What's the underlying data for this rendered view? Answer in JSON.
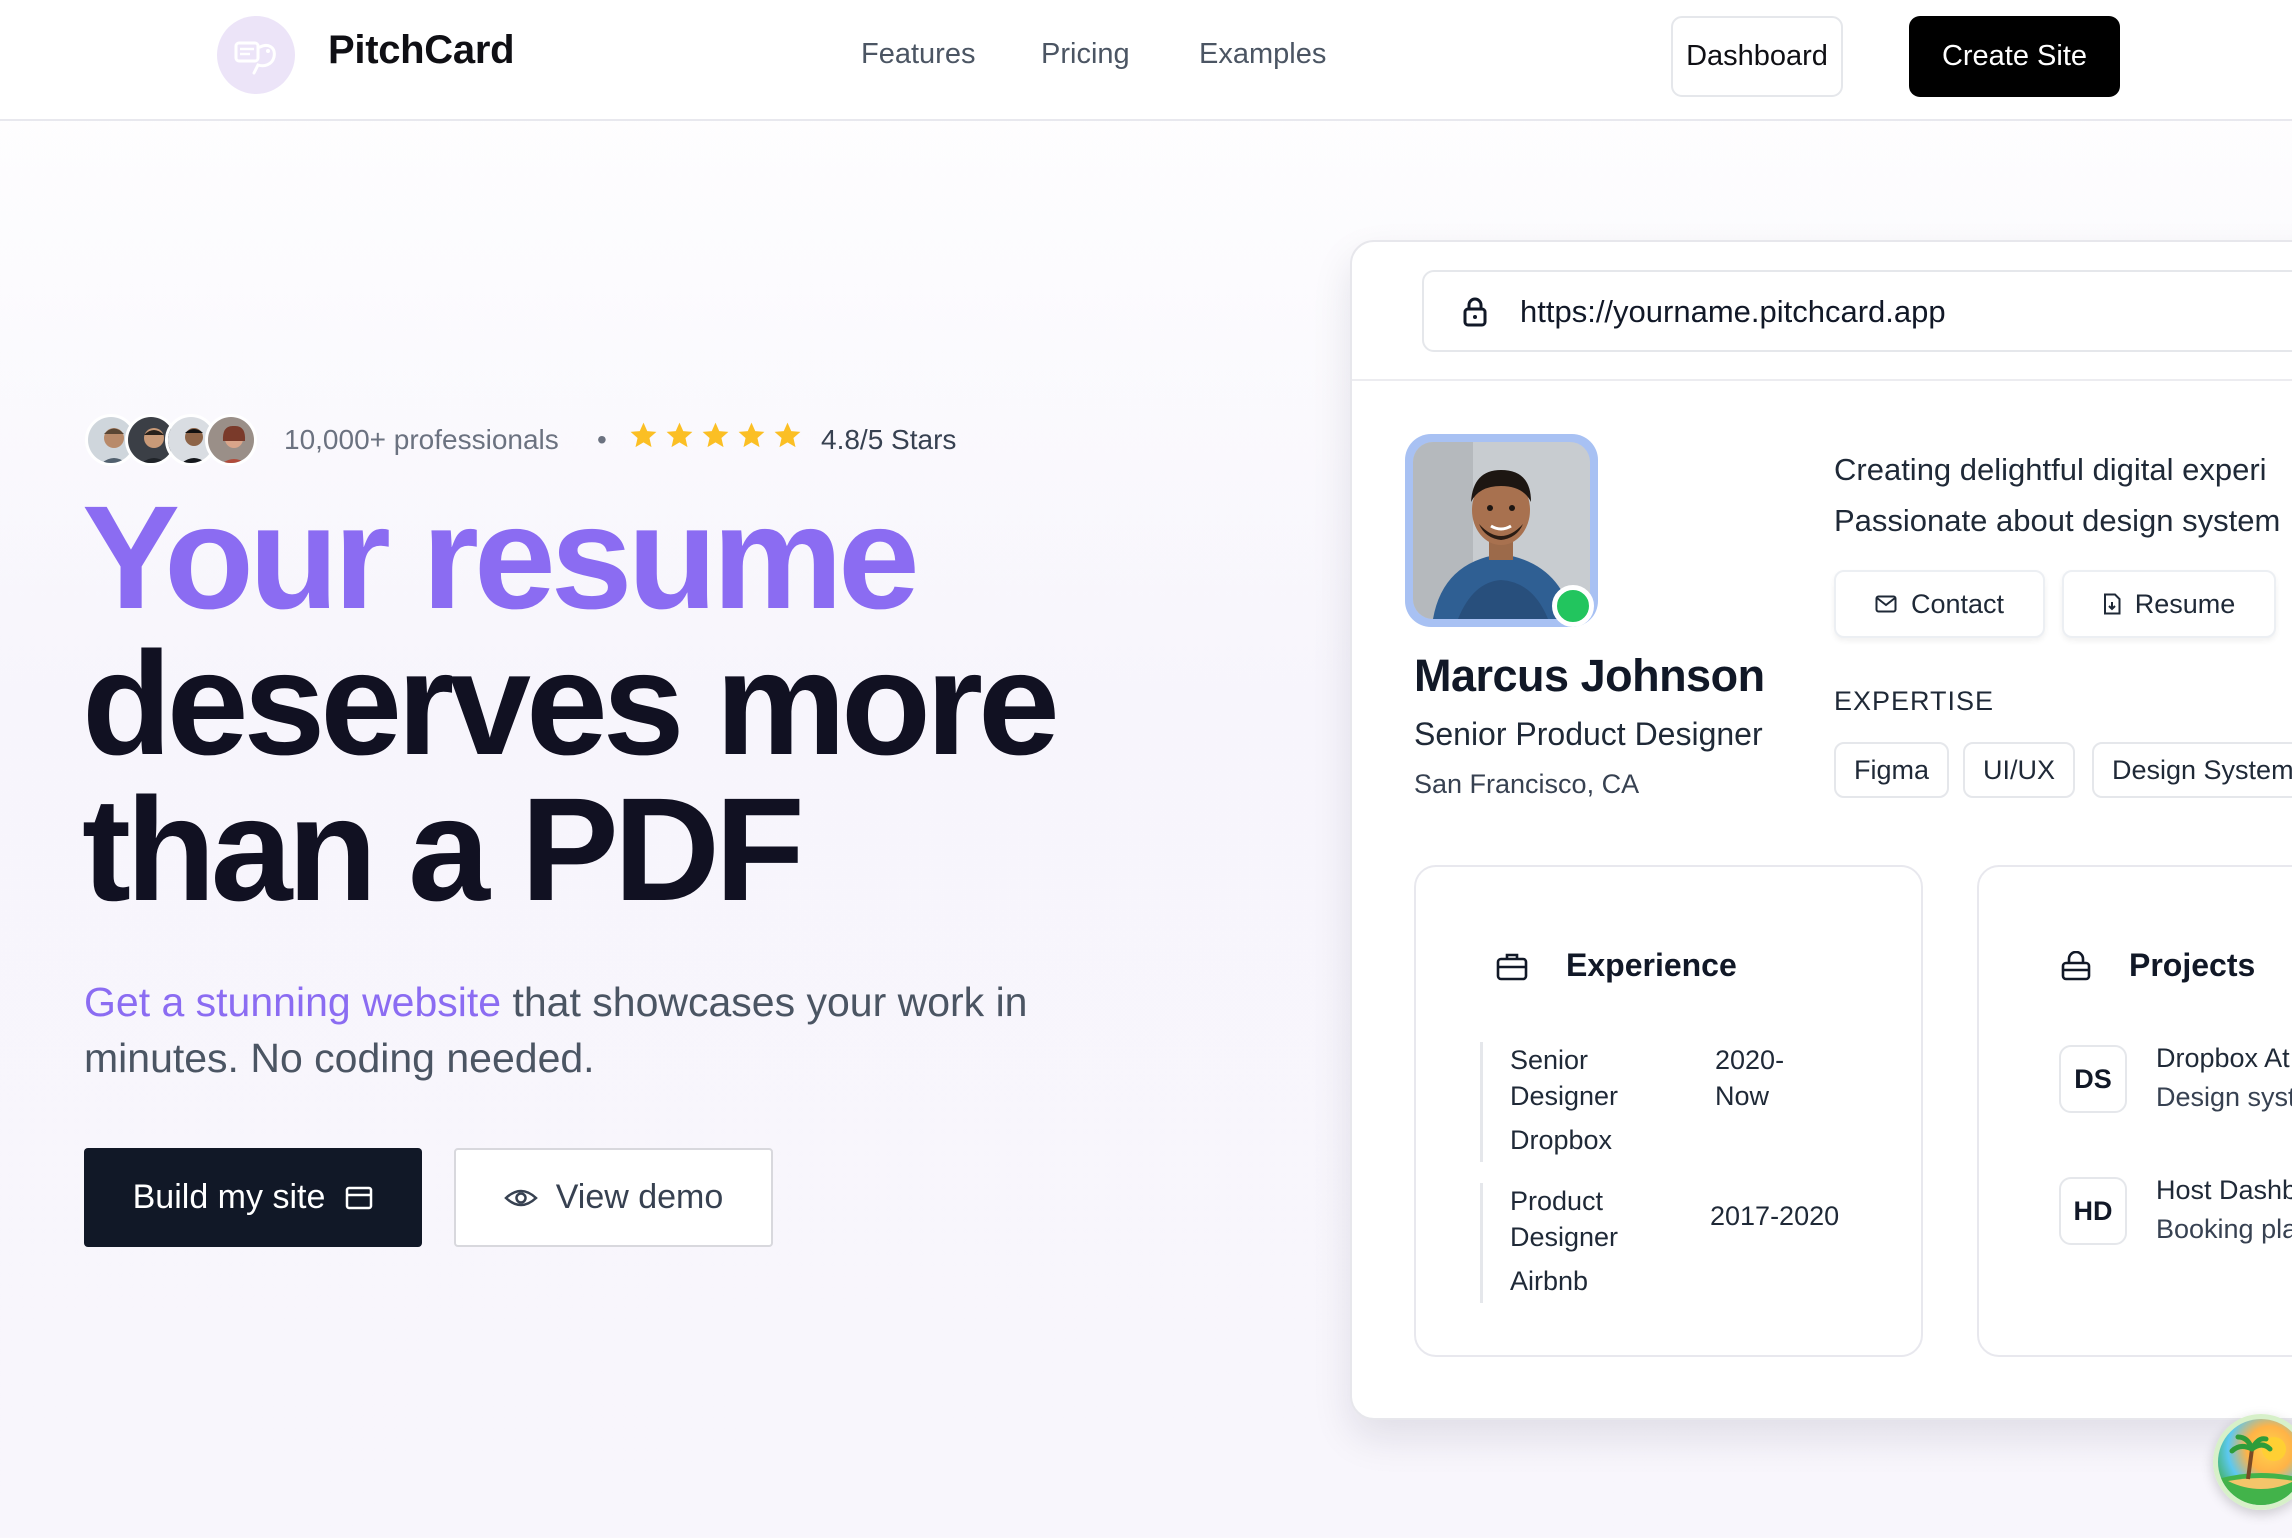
{
  "header": {
    "brand": "PitchCard",
    "nav": [
      "Features",
      "Pricing",
      "Examples"
    ],
    "dashboard_label": "Dashboard",
    "create_label": "Create Site"
  },
  "hero": {
    "social_proof": {
      "count_text": "10,000+ professionals",
      "separator": "•",
      "stars": 5,
      "rating_text": "4.8/5 Stars"
    },
    "headline": {
      "line1": "Your resume",
      "line2": "deserves more",
      "line3": "than a PDF"
    },
    "subtitle": {
      "accent": "Get a stunning website",
      "rest": " that showcases your work in minutes. No coding needed."
    },
    "build_label": "Build my site",
    "demo_label": "View demo"
  },
  "preview": {
    "url": "https://yourname.pitchcard.app",
    "profile": {
      "name": "Marcus Johnson",
      "role": "Senior Product Designer",
      "location": "San Francisco, CA",
      "bio_line1": "Creating delightful digital experi",
      "bio_line2": "Passionate about design system"
    },
    "contact_label": "Contact",
    "resume_label": "Resume",
    "expertise_label": "EXPERTISE",
    "tags": [
      "Figma",
      "UI/UX",
      "Design System"
    ],
    "experience": {
      "title": "Experience",
      "items": [
        {
          "role": "Senior Designer",
          "company": "Dropbox",
          "years": "2020-\nNow"
        },
        {
          "role": "Product Designer",
          "company": "Airbnb",
          "years": "2017-2020"
        }
      ]
    },
    "projects": {
      "title": "Projects",
      "items": [
        {
          "badge": "DS",
          "title": "Dropbox At",
          "desc": "Design syst"
        },
        {
          "badge": "HD",
          "title": "Host Dashb",
          "desc": "Booking pla"
        }
      ]
    }
  },
  "colors": {
    "accent": "#8b6cf2",
    "dark": "#111827",
    "star": "#fbbf24",
    "online": "#22c55e"
  }
}
